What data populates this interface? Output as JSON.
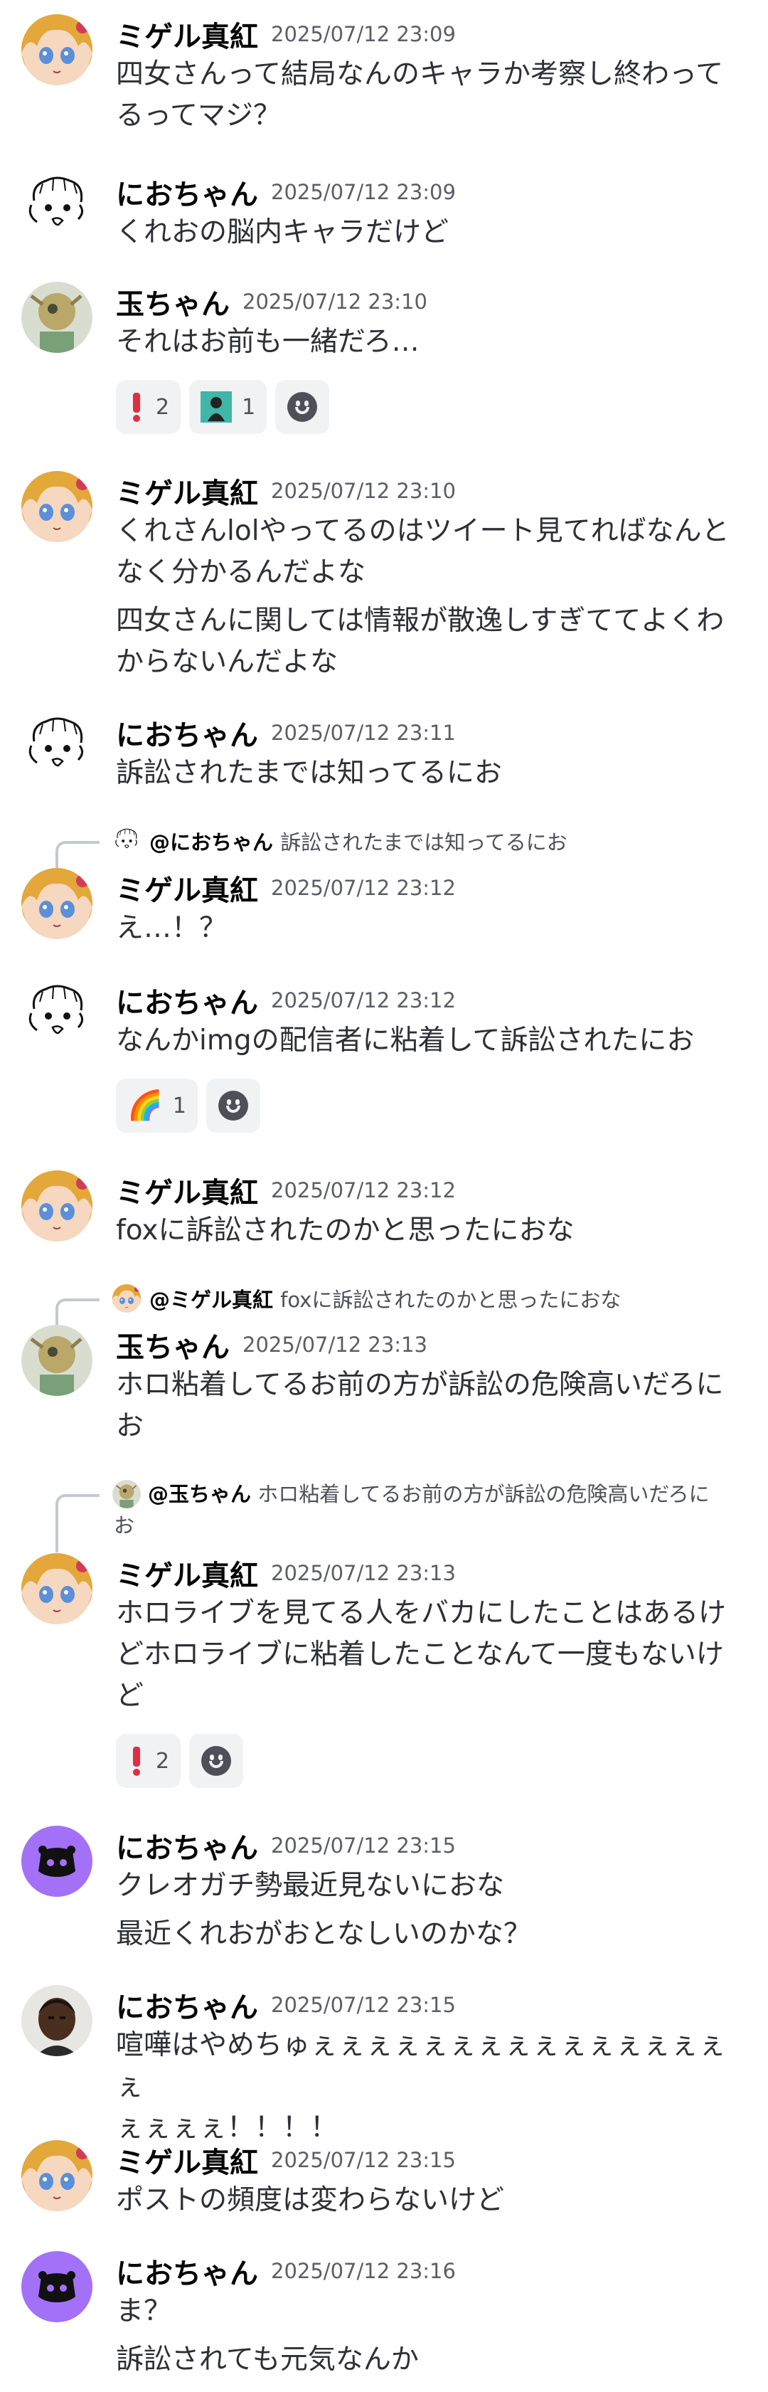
{
  "messages": [
    {
      "author": "ミゲル真紅",
      "time": "2025/07/12 23:09",
      "lines": [
        "四女さんって結局なんのキャラか考察し終わって",
        "るってマジ？"
      ],
      "avatar": "miguel-icon"
    },
    {
      "author": "におちゃん",
      "time": "2025/07/12 23:09",
      "lines": [
        "くれおの脳内キャラだけど"
      ],
      "avatar": "sketch-face-icon"
    },
    {
      "author": "玉ちゃん",
      "time": "2025/07/12 23:10",
      "lines": [
        "それはお前も一緒だろ…"
      ],
      "avatar": "tama-icon",
      "reactions": [
        {
          "emoji": "❗",
          "count": "2"
        },
        {
          "emoji": "character-emoji",
          "count": "1"
        }
      ]
    },
    {
      "author": "ミゲル真紅",
      "time": "2025/07/12 23:10",
      "lines": [
        "くれさんlolやってるのはツイート見てればなんと",
        "なく分かるんだよな",
        "四女さんに関しては情報が散逸しすぎててよくわ",
        "からないんだよな"
      ],
      "avatar": "miguel-icon"
    },
    {
      "author": "におちゃん",
      "time": "2025/07/12 23:11",
      "lines": [
        "訴訟されたまでは知ってるにお"
      ],
      "avatar": "sketch-face-icon"
    },
    {
      "author": "ミゲル真紅",
      "time": "2025/07/12 23:12",
      "lines": [
        "え…！？"
      ],
      "avatar": "miguel-icon",
      "reply": {
        "name": "@におちゃん",
        "text": "訴訟されたまでは知ってるにお"
      }
    },
    {
      "author": "におちゃん",
      "time": "2025/07/12 23:12",
      "lines": [
        "なんかimgの配信者に粘着して訴訟されたにお"
      ],
      "avatar": "sketch-face-icon",
      "reactions": [
        {
          "emoji": "🌈",
          "count": "1"
        }
      ]
    },
    {
      "author": "ミゲル真紅",
      "time": "2025/07/12 23:12",
      "lines": [
        "foxに訴訟されたのかと思ったにおな"
      ],
      "avatar": "miguel-icon"
    },
    {
      "author": "玉ちゃん",
      "time": "2025/07/12 23:13",
      "lines": [
        "ホロ粘着してるお前の方が訴訟の危険高いだろに",
        "お"
      ],
      "avatar": "tama-icon",
      "reply": {
        "name": "@ミゲル真紅",
        "text": "foxに訴訟されたのかと思ったにおな"
      }
    },
    {
      "author": "ミゲル真紅",
      "time": "2025/07/12 23:13",
      "lines": [
        "ホロライブを見てる人をバカにしたことはあるけ",
        "どホロライブに粘着したことなんて一度もないけ",
        "ど"
      ],
      "avatar": "miguel-icon",
      "reply": {
        "name": "@玉ちゃん",
        "text": "ホロ粘着してるお前の方が訴訟の危険高いだろに",
        "text2": "お"
      },
      "reactions": [
        {
          "emoji": "❗",
          "count": "2"
        }
      ]
    },
    {
      "author": "におちゃん",
      "time": "2025/07/12 23:15",
      "lines": [
        "クレオガチ勢最近見ないにおな",
        "最近くれおがおとなしいのかな？"
      ],
      "avatar": "discord-default-icon"
    },
    {
      "author": "におちゃん",
      "time": "2025/07/12 23:15",
      "lines": [
        "喧嘩はやめちゅぇぇぇぇぇぇぇぇぇぇぇぇぇぇぇぇ",
        "ぇぇぇぇ！！！！"
      ],
      "avatar": "photo-face-icon"
    },
    {
      "author": "ミゲル真紅",
      "time": "2025/07/12 23:15",
      "lines": [
        "ポストの頻度は変わらないけど"
      ],
      "avatar": "miguel-icon"
    },
    {
      "author": "におちゃん",
      "time": "2025/07/12 23:16",
      "lines": [
        "ま？",
        "訴訟されても元気なんか"
      ],
      "avatar": "discord-default-icon"
    }
  ],
  "colors": {
    "name": "#060607",
    "text": "#2e3035",
    "time": "#5c5e66",
    "reaction_bg": "#f1f2f4",
    "discord_purple": "#a371f7"
  }
}
